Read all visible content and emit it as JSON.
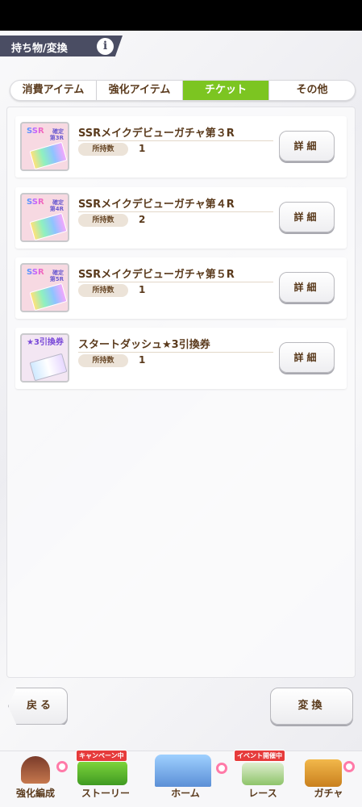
{
  "header": {
    "title": "持ち物/変換",
    "info_label": "i"
  },
  "tabs": [
    {
      "label": "消費アイテム",
      "active": false
    },
    {
      "label": "強化アイテム",
      "active": false
    },
    {
      "label": "チケット",
      "active": true
    },
    {
      "label": "その他",
      "active": false
    }
  ],
  "items": [
    {
      "name": "SSRメイクデビューガチャ第３R",
      "count_label": "所持数",
      "count": "1",
      "detail_label": "詳細",
      "icon_tag": "SSR",
      "icon_sub": "確定\n第3R"
    },
    {
      "name": "SSRメイクデビューガチャ第４R",
      "count_label": "所持数",
      "count": "2",
      "detail_label": "詳細",
      "icon_tag": "SSR",
      "icon_sub": "確定\n第4R"
    },
    {
      "name": "SSRメイクデビューガチャ第５R",
      "count_label": "所持数",
      "count": "1",
      "detail_label": "詳細",
      "icon_tag": "SSR",
      "icon_sub": "確定\n第5R"
    },
    {
      "name": "スタートダッシュ★3引換券",
      "count_label": "所持数",
      "count": "1",
      "detail_label": "詳細",
      "icon_tag": "★3引換券",
      "icon_sub": ""
    }
  ],
  "footer": {
    "back_label": "戻る",
    "convert_label": "変換"
  },
  "nav": [
    {
      "label": "強化編成",
      "sub_badge": ""
    },
    {
      "label": "ストーリー",
      "sub_badge": "キャンペーン中"
    },
    {
      "label": "ホーム",
      "sub_badge": ""
    },
    {
      "label": "レース",
      "sub_badge": "イベント開催中"
    },
    {
      "label": "ガチャ",
      "sub_badge": ""
    }
  ],
  "colors": {
    "accent_green": "#7cc521",
    "header_bg": "#4a4d63",
    "text_brown": "#5a3a1c",
    "badge_pink": "#ff7aa8"
  }
}
